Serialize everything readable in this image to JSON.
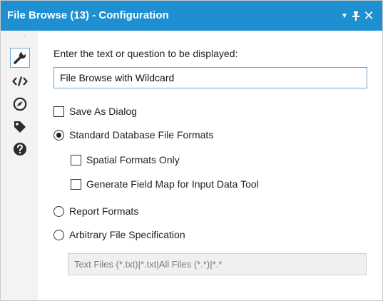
{
  "titlebar": {
    "title": "File Browse (13) - Configuration",
    "dropdown_icon": "▼",
    "pin_icon": "pin-icon",
    "close_icon": "✕",
    "background": "#1e8fd0"
  },
  "rail": {
    "grip": "· · ·",
    "tabs": [
      {
        "name": "configuration",
        "icon": "wrench-icon",
        "active": true
      },
      {
        "name": "code",
        "icon": "code-icon",
        "active": false
      },
      {
        "name": "annotation",
        "icon": "compass-icon",
        "active": false
      },
      {
        "name": "tags",
        "icon": "tag-icon",
        "active": false
      },
      {
        "name": "help",
        "icon": "help-icon",
        "active": false
      }
    ]
  },
  "config": {
    "prompt_label": "Enter the text or question to be displayed:",
    "prompt_value": "File Browse with Wildcard",
    "save_as_dialog": {
      "label": "Save As Dialog",
      "checked": false
    },
    "standard_formats": {
      "label": "Standard Database File Formats",
      "selected": true
    },
    "spatial_only": {
      "label": "Spatial Formats Only",
      "checked": false
    },
    "field_map": {
      "label": "Generate Field Map for Input Data Tool",
      "checked": false
    },
    "report_formats": {
      "label": "Report Formats",
      "selected": false
    },
    "arbitrary_spec": {
      "label": "Arbitrary File Specification",
      "selected": false
    },
    "spec_value": "Text Files (*.txt)|*.txt|All Files (*.*)|*.*"
  }
}
